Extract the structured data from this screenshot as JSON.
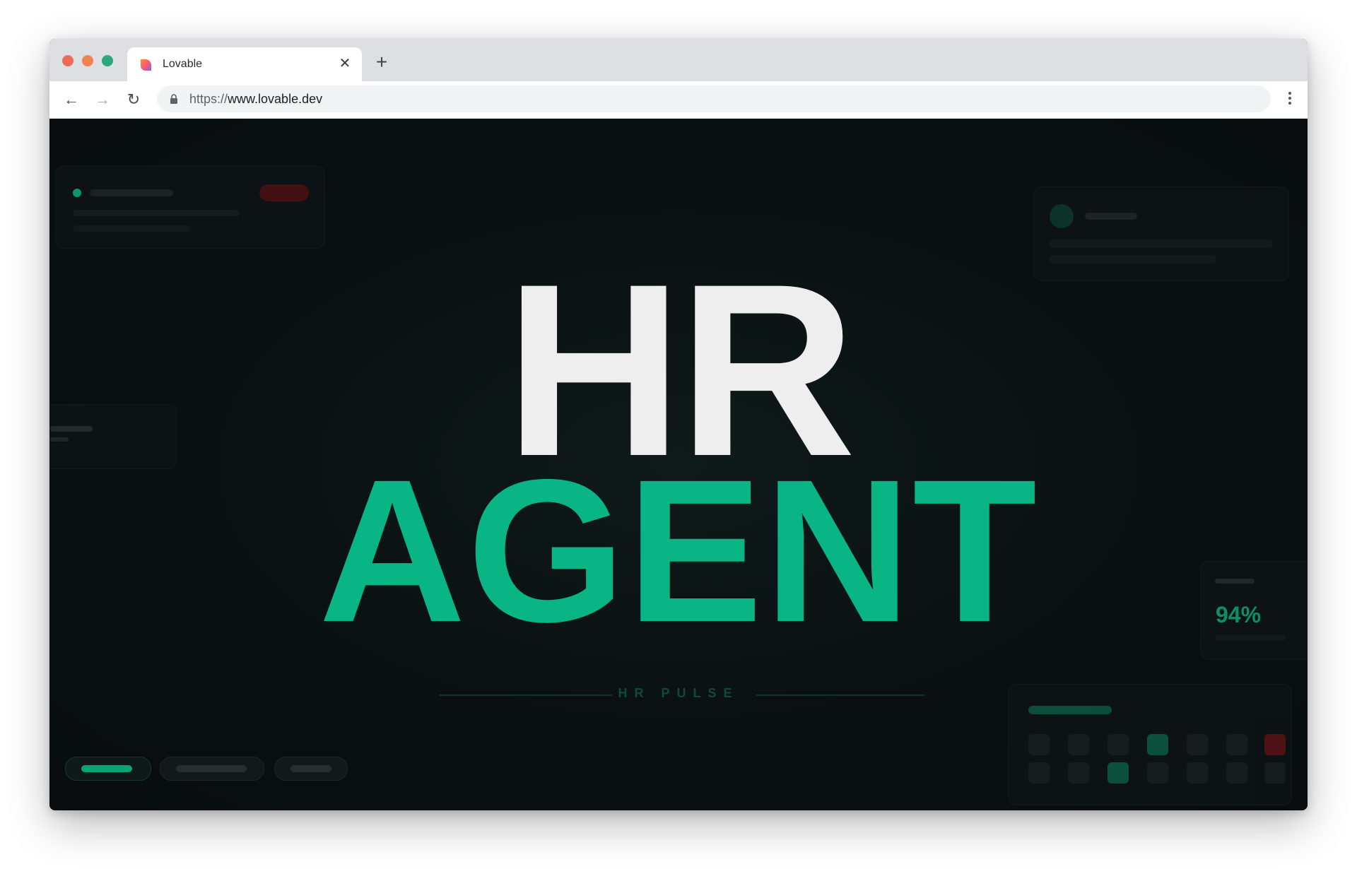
{
  "browser": {
    "tab_title": "Lovable",
    "url_scheme": "https://",
    "url_host": "www.lovable.dev",
    "icons": [
      "close-icon",
      "plus-icon",
      "back-arrow-icon",
      "forward-arrow-icon",
      "reload-icon",
      "lock-icon",
      "kebab-menu-icon"
    ]
  },
  "hero": {
    "line1": "HR",
    "line2": "AGENT",
    "subtitle": "HR PULSE"
  },
  "stats_card": {
    "value": "94%"
  },
  "colors": {
    "accent_green": "#09b585",
    "background": "#0a0f11",
    "hero_white": "#eeeeee",
    "alert_red": "#5a1518"
  }
}
